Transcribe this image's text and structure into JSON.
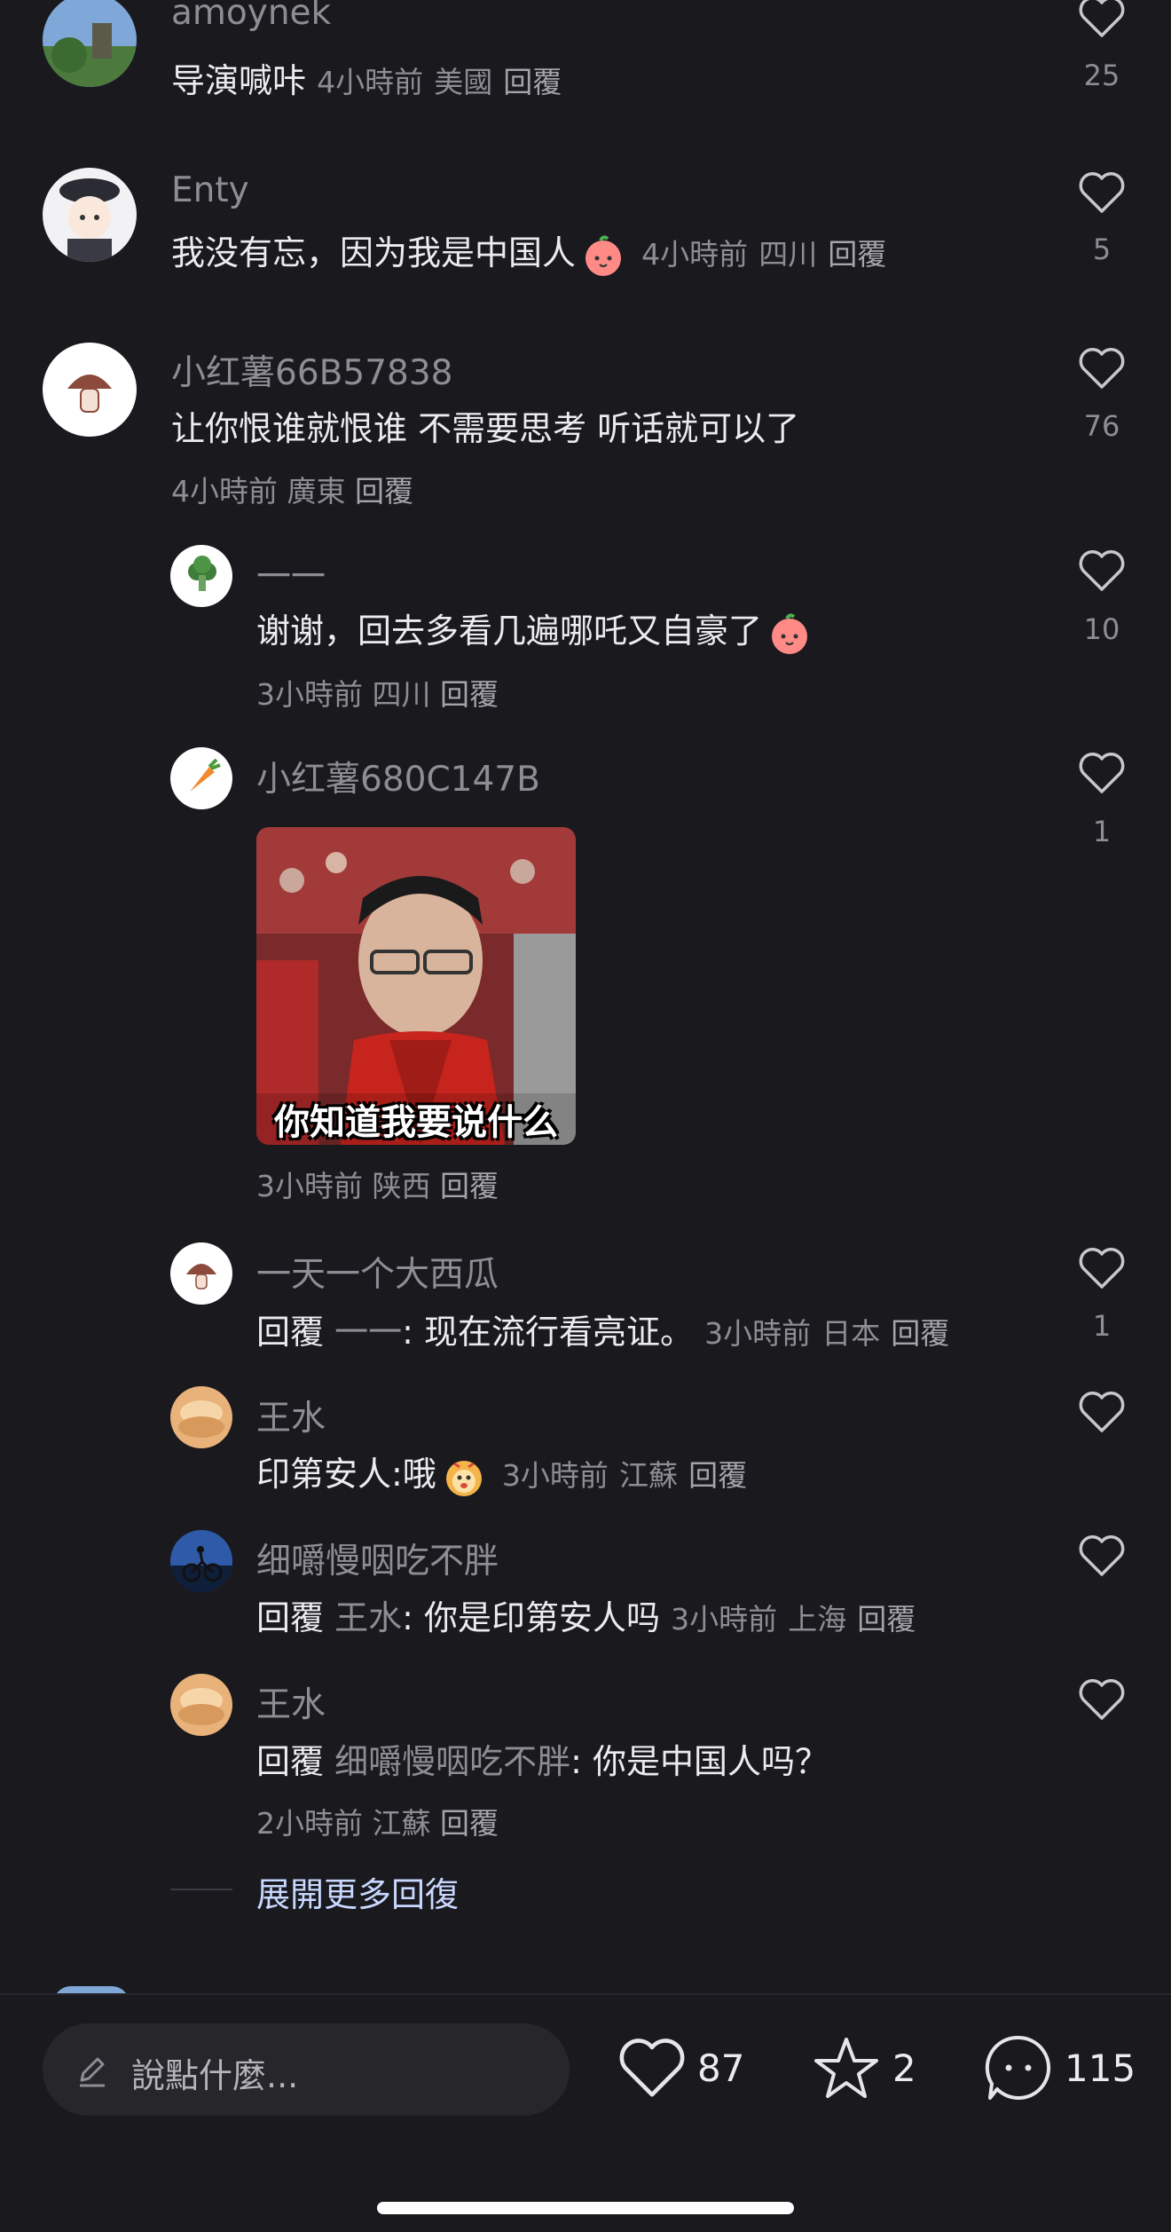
{
  "comments": [
    {
      "name": "amoynek",
      "text": "导演喊咔",
      "time": "4小時前",
      "location": "美國",
      "reply": "回覆",
      "likes": "25"
    },
    {
      "name": "Enty",
      "text": "我没有忘，因为我是中国人",
      "time": "4小時前",
      "location": "四川",
      "reply": "回覆",
      "likes": "5"
    },
    {
      "name": "小红薯66B57838",
      "text": "让你恨谁就恨谁 不需要思考 听话就可以了",
      "time": "4小時前",
      "location": "廣東",
      "reply": "回覆",
      "likes": "76"
    }
  ],
  "replies": [
    {
      "name": "一一",
      "text": "谢谢，回去多看几遍哪吒又自豪了",
      "time": "3小時前",
      "location": "四川",
      "reply": "回覆",
      "likes": "10"
    },
    {
      "name": "小红薯680C147B",
      "image_caption": "你知道我要说什么",
      "time": "3小時前",
      "location": "陕西",
      "reply": "回覆",
      "likes": "1"
    },
    {
      "name": "一天一个大西瓜",
      "reply_prefix": "回覆",
      "reply_to": "一一",
      "text": ": 现在流行看亮证。",
      "time": "3小時前",
      "location": "日本",
      "reply": "回覆",
      "likes": "1"
    },
    {
      "name": "王水",
      "text": "印第安人:哦",
      "time": "3小時前",
      "location": "江蘇",
      "reply": "回覆",
      "likes": ""
    },
    {
      "name": "细嚼慢咽吃不胖",
      "reply_prefix": "回覆",
      "reply_to": "王水",
      "text": ": 你是印第安人吗",
      "time": "3小時前",
      "location": "上海",
      "reply": "回覆",
      "likes": ""
    },
    {
      "name": "王水",
      "reply_prefix": "回覆",
      "reply_to": "细嚼慢咽吃不胖",
      "text": ": 你是中国人吗？",
      "time": "2小時前",
      "location": "江蘇",
      "reply": "回覆",
      "likes": ""
    }
  ],
  "expand_more": "展開更多回復",
  "bottom_bar": {
    "input_placeholder": "說點什麼...",
    "like_count": "87",
    "star_count": "2",
    "comment_count": "115"
  },
  "colors": {
    "background": "#19191e",
    "text": "#ececef",
    "muted": "#8d8d93",
    "link": "#c9d8ff"
  }
}
